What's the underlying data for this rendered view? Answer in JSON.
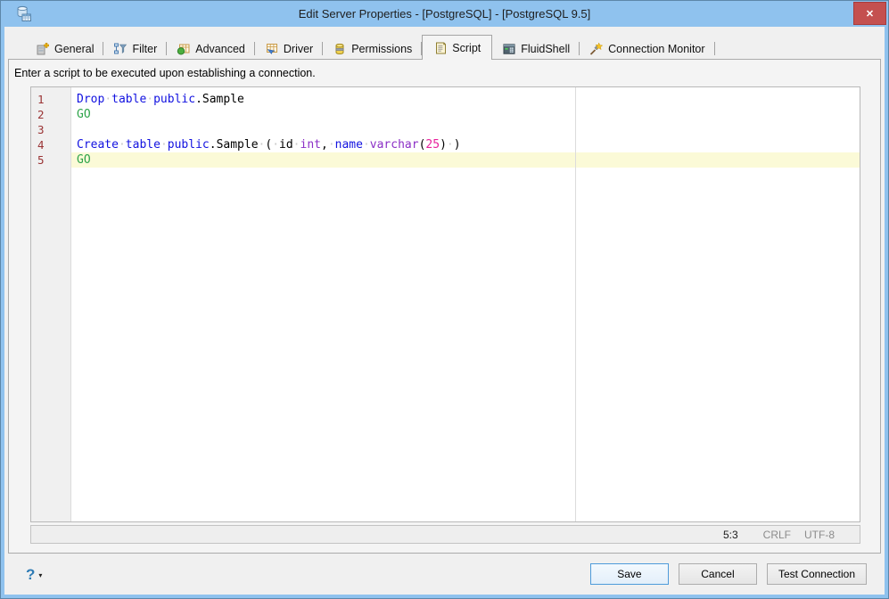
{
  "window": {
    "title": "Edit Server Properties - [PostgreSQL] - [PostgreSQL 9.5]",
    "app_icon": "database-server-icon",
    "close_glyph": "✕"
  },
  "tabs": [
    {
      "id": "general",
      "label": "General",
      "icon": "general-icon",
      "selected": false
    },
    {
      "id": "filter",
      "label": "Filter",
      "icon": "filter-icon",
      "selected": false
    },
    {
      "id": "advanced",
      "label": "Advanced",
      "icon": "advanced-icon",
      "selected": false
    },
    {
      "id": "driver",
      "label": "Driver",
      "icon": "driver-icon",
      "selected": false
    },
    {
      "id": "permissions",
      "label": "Permissions",
      "icon": "permissions-icon",
      "selected": false
    },
    {
      "id": "script",
      "label": "Script",
      "icon": "script-icon",
      "selected": true
    },
    {
      "id": "fluidshell",
      "label": "FluidShell",
      "icon": "fluidshell-icon",
      "selected": false
    },
    {
      "id": "connection-monitor",
      "label": "Connection Monitor",
      "icon": "connection-monitor-icon",
      "selected": false
    }
  ],
  "instruction": "Enter a script to be executed upon establishing a connection.",
  "editor": {
    "lines": [
      {
        "num": "1",
        "current": false,
        "tokens": [
          [
            "Drop",
            "kw"
          ],
          [
            " ",
            "ws"
          ],
          [
            "table",
            "kw"
          ],
          [
            " ",
            "ws"
          ],
          [
            "public",
            "kw"
          ],
          [
            ".",
            "pl"
          ],
          [
            "Sample",
            "pl"
          ]
        ]
      },
      {
        "num": "2",
        "current": false,
        "tokens": [
          [
            "GO",
            "go"
          ]
        ]
      },
      {
        "num": "3",
        "current": false,
        "tokens": []
      },
      {
        "num": "4",
        "current": false,
        "tokens": [
          [
            "Create",
            "kw"
          ],
          [
            " ",
            "ws"
          ],
          [
            "table",
            "kw"
          ],
          [
            " ",
            "ws"
          ],
          [
            "public",
            "kw"
          ],
          [
            ".",
            "pl"
          ],
          [
            "Sample",
            "pl"
          ],
          [
            " ",
            "ws"
          ],
          [
            "(",
            "pl"
          ],
          [
            " ",
            "ws"
          ],
          [
            "id",
            "pl"
          ],
          [
            " ",
            "ws"
          ],
          [
            "int",
            "type"
          ],
          [
            ",",
            "pl"
          ],
          [
            " ",
            "ws"
          ],
          [
            "name",
            "kw"
          ],
          [
            " ",
            "ws"
          ],
          [
            "varchar",
            "type"
          ],
          [
            "(",
            "pl"
          ],
          [
            "25",
            "num"
          ],
          [
            ")",
            "pl"
          ],
          [
            " ",
            "ws"
          ],
          [
            ")",
            "pl"
          ]
        ]
      },
      {
        "num": "5",
        "current": true,
        "tokens": [
          [
            "GO",
            "go"
          ]
        ]
      }
    ],
    "status": {
      "caret": "5:3",
      "line_ending": "CRLF",
      "encoding": "UTF-8"
    }
  },
  "footer": {
    "help_glyph": "?",
    "dropdown_glyph": "▾",
    "buttons": [
      {
        "id": "save",
        "label": "Save",
        "default": true
      },
      {
        "id": "cancel",
        "label": "Cancel",
        "default": false
      },
      {
        "id": "test-connection",
        "label": "Test Connection",
        "default": false
      }
    ]
  },
  "colors": {
    "keyword": "#1212e0",
    "go_keyword": "#2ea44a",
    "type_keyword": "#8b2fc6",
    "number": "#e8219c",
    "line_number": "#9a3334",
    "current_line_bg": "#fbfad7",
    "titlebar_bg": "#8fc2ee",
    "close_button_bg": "#c4504f",
    "default_button_border": "#4e9bda"
  }
}
